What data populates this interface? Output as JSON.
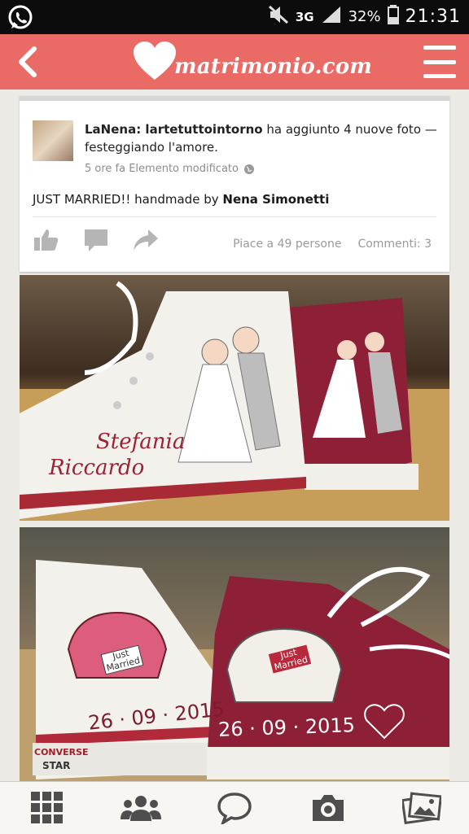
{
  "status_bar": {
    "network": "3G",
    "battery": "32%",
    "time": "21:31"
  },
  "app_bar": {
    "brand": "matrimonio.com"
  },
  "post": {
    "author": "LaNena: lartetuttointorno",
    "action": "ha aggiunto 4 nuove foto — festeggiando l'amore.",
    "time_meta": "5 ore fa Elemento modificato",
    "text_prefix": "JUST MARRIED!! handmade by",
    "text_name": "Nena Simonetti",
    "likes": "Piace a 49 persone",
    "comments": "Commenti: 3"
  },
  "photo1": {
    "name_1": "Stefania",
    "name_2": "Riccardo"
  },
  "photo2": {
    "plate_1": "Just Married",
    "plate_2": "Just Married",
    "date_1": "26 · 09 · 2015",
    "date_2": "26 · 09 · 2015",
    "brand_1": "CONVERSE",
    "brand_2": "STAR"
  },
  "colors": {
    "app_bar": "#ea6a66",
    "status_bar": "#0c0c0c",
    "shoe_red": "#8d1f37",
    "shoe_white": "#f3f1ec"
  },
  "bottom_nav": {
    "icons": [
      "grid-icon",
      "community-icon",
      "chat-icon",
      "camera-icon",
      "gallery-icon"
    ]
  }
}
